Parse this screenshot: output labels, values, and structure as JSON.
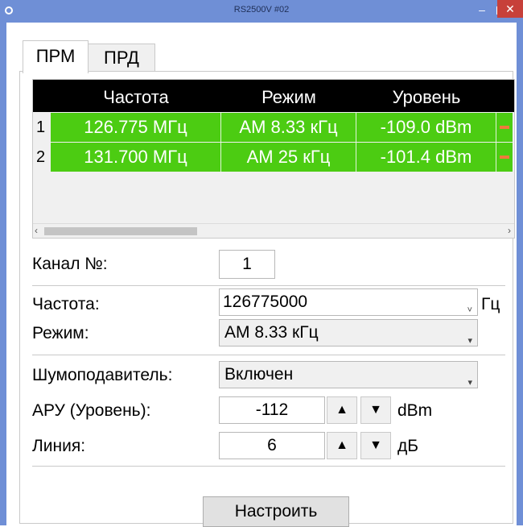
{
  "window": {
    "title": "RS2500V #02"
  },
  "tabs": [
    {
      "label": "ПРМ"
    },
    {
      "label": "ПРД"
    }
  ],
  "table": {
    "columns": [
      "Частота",
      "Режим",
      "Уровень"
    ],
    "rows": [
      {
        "num": "1",
        "freq": "126.775 МГц",
        "mode": "AM 8.33 кГц",
        "level": "-109.0 dBm"
      },
      {
        "num": "2",
        "freq": "131.700 МГц",
        "mode": "AM 25 кГц",
        "level": "-101.4 dBm"
      }
    ],
    "row_color": "#4ccc12",
    "marker_color": "#f07a3c"
  },
  "form": {
    "channel_label": "Канал №:",
    "channel_value": "1",
    "freq_label": "Частота:",
    "freq_value": "126775000",
    "freq_unit": "Гц",
    "mode_label": "Режим:",
    "mode_value": "AM 8.33 кГц",
    "squelch_label": "Шумоподавитель:",
    "squelch_value": "Включен",
    "agc_label": "АРУ (Уровень):",
    "agc_value": "-112",
    "agc_unit": "dBm",
    "line_label": "Линия:",
    "line_value": "6",
    "line_unit": "дБ",
    "apply_button": "Настроить"
  },
  "icons": {
    "minimize": "minimize-icon",
    "maximize": "maximize-icon",
    "close": "close-icon",
    "spin_up": "triangle-up-icon",
    "spin_down": "triangle-down-icon"
  }
}
